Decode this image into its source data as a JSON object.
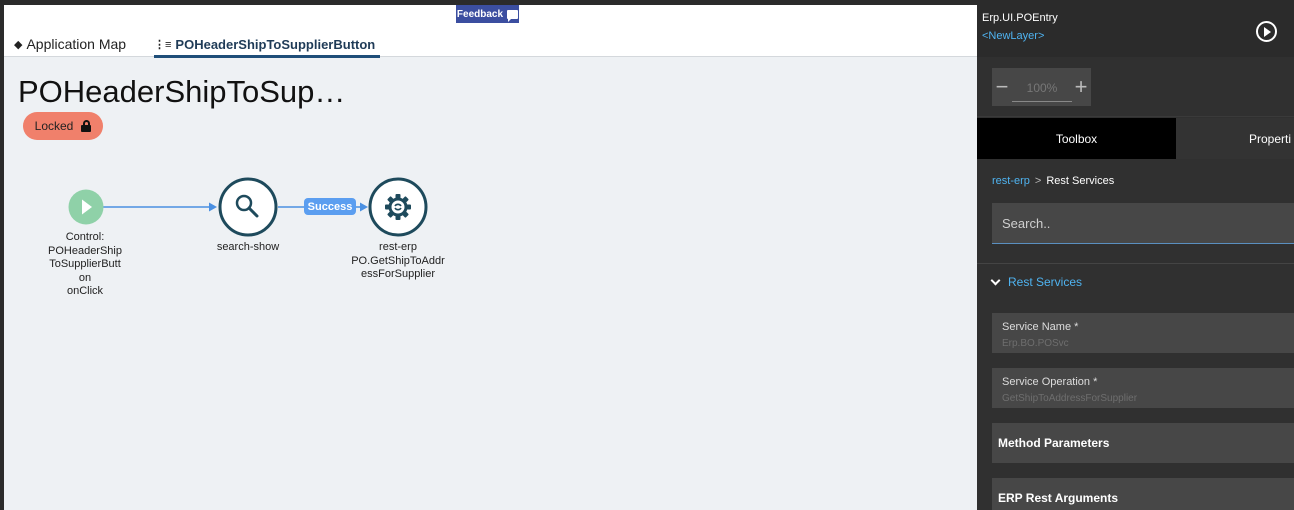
{
  "tabs": {
    "application_map": "Application Map",
    "active_event": "POHeaderShipToSupplierButton"
  },
  "feedback": {
    "label": "Feedback"
  },
  "page": {
    "title": "POHeaderShipToSup…",
    "status": "Locked"
  },
  "flow": {
    "nodes": [
      {
        "id": "trigger",
        "icon": "play-icon",
        "label_lines": [
          "Control:",
          "POHeaderShip",
          "ToSupplierButt",
          "on",
          "onClick"
        ]
      },
      {
        "id": "search-show",
        "icon": "search-icon",
        "label_lines": [
          "search-show"
        ]
      },
      {
        "id": "rest-erp",
        "icon": "gear-icon",
        "label_lines": [
          "rest-erp",
          "PO.GetShipToAddr",
          "essForSupplier"
        ]
      }
    ],
    "edges": [
      {
        "from": "trigger",
        "to": "search-show",
        "label": ""
      },
      {
        "from": "search-show",
        "to": "rest-erp",
        "label": "Success"
      }
    ],
    "colors": {
      "edge": "#4a90e2",
      "node_border": "#1e4a5c",
      "trigger": "#8fd1a8"
    }
  },
  "panel": {
    "form_name": "Erp.UI.POEntry",
    "layer": "<NewLayer>",
    "zoom": "100%",
    "tabs": {
      "toolbox": "Toolbox",
      "properties": "Properti"
    },
    "breadcrumb": {
      "root": "rest-erp",
      "separator": ">",
      "current": "Rest Services"
    },
    "search_placeholder": "Search..",
    "section": "Rest Services",
    "fields": [
      {
        "label": "Service Name *",
        "value": "Erp.BO.POSvc"
      },
      {
        "label": "Service Operation *",
        "value": "GetShipToAddressForSupplier"
      }
    ],
    "groups": [
      "Method Parameters",
      "ERP Rest Arguments"
    ]
  }
}
